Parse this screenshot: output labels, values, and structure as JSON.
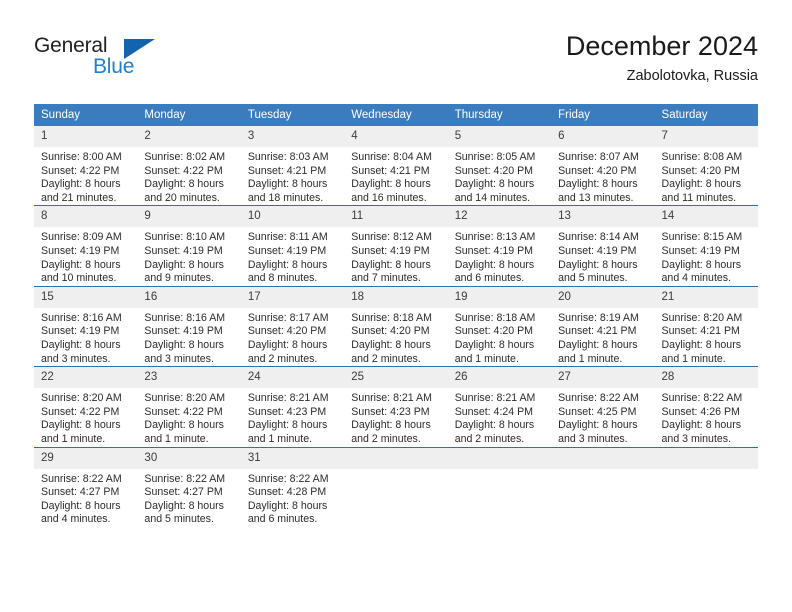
{
  "brand": {
    "name_top": "General",
    "name_bottom": "Blue",
    "accent_color": "#1f7fd0",
    "triangle_color": "#1164ad"
  },
  "header": {
    "title": "December 2024",
    "subtitle": "Zabolotovka, Russia"
  },
  "calendar": {
    "header_bg": "#3a7cbe",
    "daynum_bg": "#efefef",
    "grid_line_color": "#2f6fae",
    "weekday_headers": [
      "Sunday",
      "Monday",
      "Tuesday",
      "Wednesday",
      "Thursday",
      "Friday",
      "Saturday"
    ],
    "weeks": [
      [
        {
          "day": "1",
          "sunrise": "Sunrise: 8:00 AM",
          "sunset": "Sunset: 4:22 PM",
          "daylight_line1": "Daylight: 8 hours",
          "daylight_line2": "and 21 minutes."
        },
        {
          "day": "2",
          "sunrise": "Sunrise: 8:02 AM",
          "sunset": "Sunset: 4:22 PM",
          "daylight_line1": "Daylight: 8 hours",
          "daylight_line2": "and 20 minutes."
        },
        {
          "day": "3",
          "sunrise": "Sunrise: 8:03 AM",
          "sunset": "Sunset: 4:21 PM",
          "daylight_line1": "Daylight: 8 hours",
          "daylight_line2": "and 18 minutes."
        },
        {
          "day": "4",
          "sunrise": "Sunrise: 8:04 AM",
          "sunset": "Sunset: 4:21 PM",
          "daylight_line1": "Daylight: 8 hours",
          "daylight_line2": "and 16 minutes."
        },
        {
          "day": "5",
          "sunrise": "Sunrise: 8:05 AM",
          "sunset": "Sunset: 4:20 PM",
          "daylight_line1": "Daylight: 8 hours",
          "daylight_line2": "and 14 minutes."
        },
        {
          "day": "6",
          "sunrise": "Sunrise: 8:07 AM",
          "sunset": "Sunset: 4:20 PM",
          "daylight_line1": "Daylight: 8 hours",
          "daylight_line2": "and 13 minutes."
        },
        {
          "day": "7",
          "sunrise": "Sunrise: 8:08 AM",
          "sunset": "Sunset: 4:20 PM",
          "daylight_line1": "Daylight: 8 hours",
          "daylight_line2": "and 11 minutes."
        }
      ],
      [
        {
          "day": "8",
          "sunrise": "Sunrise: 8:09 AM",
          "sunset": "Sunset: 4:19 PM",
          "daylight_line1": "Daylight: 8 hours",
          "daylight_line2": "and 10 minutes."
        },
        {
          "day": "9",
          "sunrise": "Sunrise: 8:10 AM",
          "sunset": "Sunset: 4:19 PM",
          "daylight_line1": "Daylight: 8 hours",
          "daylight_line2": "and 9 minutes."
        },
        {
          "day": "10",
          "sunrise": "Sunrise: 8:11 AM",
          "sunset": "Sunset: 4:19 PM",
          "daylight_line1": "Daylight: 8 hours",
          "daylight_line2": "and 8 minutes."
        },
        {
          "day": "11",
          "sunrise": "Sunrise: 8:12 AM",
          "sunset": "Sunset: 4:19 PM",
          "daylight_line1": "Daylight: 8 hours",
          "daylight_line2": "and 7 minutes."
        },
        {
          "day": "12",
          "sunrise": "Sunrise: 8:13 AM",
          "sunset": "Sunset: 4:19 PM",
          "daylight_line1": "Daylight: 8 hours",
          "daylight_line2": "and 6 minutes."
        },
        {
          "day": "13",
          "sunrise": "Sunrise: 8:14 AM",
          "sunset": "Sunset: 4:19 PM",
          "daylight_line1": "Daylight: 8 hours",
          "daylight_line2": "and 5 minutes."
        },
        {
          "day": "14",
          "sunrise": "Sunrise: 8:15 AM",
          "sunset": "Sunset: 4:19 PM",
          "daylight_line1": "Daylight: 8 hours",
          "daylight_line2": "and 4 minutes."
        }
      ],
      [
        {
          "day": "15",
          "sunrise": "Sunrise: 8:16 AM",
          "sunset": "Sunset: 4:19 PM",
          "daylight_line1": "Daylight: 8 hours",
          "daylight_line2": "and 3 minutes."
        },
        {
          "day": "16",
          "sunrise": "Sunrise: 8:16 AM",
          "sunset": "Sunset: 4:19 PM",
          "daylight_line1": "Daylight: 8 hours",
          "daylight_line2": "and 3 minutes."
        },
        {
          "day": "17",
          "sunrise": "Sunrise: 8:17 AM",
          "sunset": "Sunset: 4:20 PM",
          "daylight_line1": "Daylight: 8 hours",
          "daylight_line2": "and 2 minutes."
        },
        {
          "day": "18",
          "sunrise": "Sunrise: 8:18 AM",
          "sunset": "Sunset: 4:20 PM",
          "daylight_line1": "Daylight: 8 hours",
          "daylight_line2": "and 2 minutes."
        },
        {
          "day": "19",
          "sunrise": "Sunrise: 8:18 AM",
          "sunset": "Sunset: 4:20 PM",
          "daylight_line1": "Daylight: 8 hours",
          "daylight_line2": "and 1 minute."
        },
        {
          "day": "20",
          "sunrise": "Sunrise: 8:19 AM",
          "sunset": "Sunset: 4:21 PM",
          "daylight_line1": "Daylight: 8 hours",
          "daylight_line2": "and 1 minute."
        },
        {
          "day": "21",
          "sunrise": "Sunrise: 8:20 AM",
          "sunset": "Sunset: 4:21 PM",
          "daylight_line1": "Daylight: 8 hours",
          "daylight_line2": "and 1 minute."
        }
      ],
      [
        {
          "day": "22",
          "sunrise": "Sunrise: 8:20 AM",
          "sunset": "Sunset: 4:22 PM",
          "daylight_line1": "Daylight: 8 hours",
          "daylight_line2": "and 1 minute."
        },
        {
          "day": "23",
          "sunrise": "Sunrise: 8:20 AM",
          "sunset": "Sunset: 4:22 PM",
          "daylight_line1": "Daylight: 8 hours",
          "daylight_line2": "and 1 minute."
        },
        {
          "day": "24",
          "sunrise": "Sunrise: 8:21 AM",
          "sunset": "Sunset: 4:23 PM",
          "daylight_line1": "Daylight: 8 hours",
          "daylight_line2": "and 1 minute."
        },
        {
          "day": "25",
          "sunrise": "Sunrise: 8:21 AM",
          "sunset": "Sunset: 4:23 PM",
          "daylight_line1": "Daylight: 8 hours",
          "daylight_line2": "and 2 minutes."
        },
        {
          "day": "26",
          "sunrise": "Sunrise: 8:21 AM",
          "sunset": "Sunset: 4:24 PM",
          "daylight_line1": "Daylight: 8 hours",
          "daylight_line2": "and 2 minutes."
        },
        {
          "day": "27",
          "sunrise": "Sunrise: 8:22 AM",
          "sunset": "Sunset: 4:25 PM",
          "daylight_line1": "Daylight: 8 hours",
          "daylight_line2": "and 3 minutes."
        },
        {
          "day": "28",
          "sunrise": "Sunrise: 8:22 AM",
          "sunset": "Sunset: 4:26 PM",
          "daylight_line1": "Daylight: 8 hours",
          "daylight_line2": "and 3 minutes."
        }
      ],
      [
        {
          "day": "29",
          "sunrise": "Sunrise: 8:22 AM",
          "sunset": "Sunset: 4:27 PM",
          "daylight_line1": "Daylight: 8 hours",
          "daylight_line2": "and 4 minutes."
        },
        {
          "day": "30",
          "sunrise": "Sunrise: 8:22 AM",
          "sunset": "Sunset: 4:27 PM",
          "daylight_line1": "Daylight: 8 hours",
          "daylight_line2": "and 5 minutes."
        },
        {
          "day": "31",
          "sunrise": "Sunrise: 8:22 AM",
          "sunset": "Sunset: 4:28 PM",
          "daylight_line1": "Daylight: 8 hours",
          "daylight_line2": "and 6 minutes."
        },
        {
          "day": "",
          "sunrise": "",
          "sunset": "",
          "daylight_line1": "",
          "daylight_line2": ""
        },
        {
          "day": "",
          "sunrise": "",
          "sunset": "",
          "daylight_line1": "",
          "daylight_line2": ""
        },
        {
          "day": "",
          "sunrise": "",
          "sunset": "",
          "daylight_line1": "",
          "daylight_line2": ""
        },
        {
          "day": "",
          "sunrise": "",
          "sunset": "",
          "daylight_line1": "",
          "daylight_line2": ""
        }
      ]
    ]
  }
}
